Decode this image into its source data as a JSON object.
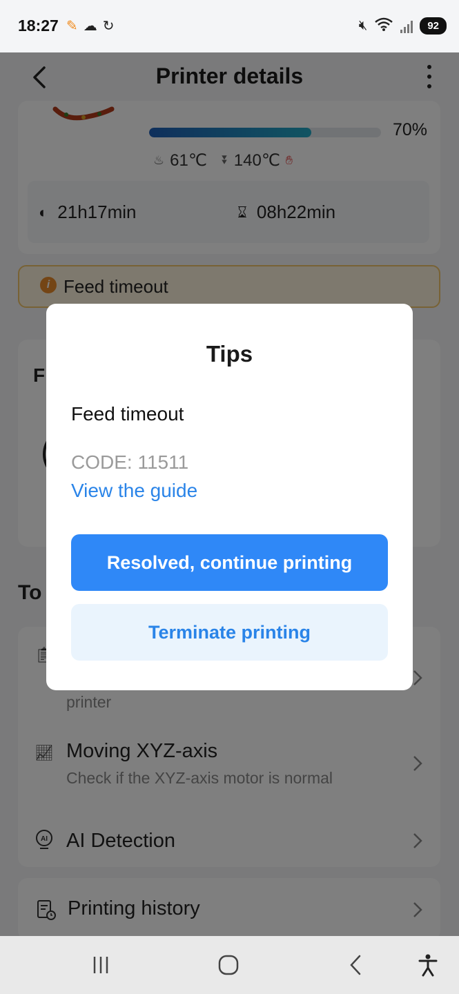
{
  "status_bar": {
    "time": "18:27",
    "battery": "92",
    "notif_icons": [
      "app-notification-icon",
      "weather-icon",
      "sync-icon"
    ],
    "right_icons": [
      "mute-icon",
      "wifi-icon",
      "signal-icon"
    ]
  },
  "header": {
    "title": "Printer details"
  },
  "print_status": {
    "progress": 0.7,
    "progress_label": "70%",
    "bed_temp": "61℃",
    "nozzle_temp": "140℃",
    "elapsed_time": "21h17min",
    "remaining_time": "08h22min"
  },
  "warning": {
    "text": "Feed timeout"
  },
  "filament": {
    "title": "F"
  },
  "tools": {
    "heading": "To",
    "items": [
      {
        "title": "",
        "subtitle": "printer"
      },
      {
        "title": "Moving XYZ-axis",
        "subtitle": "Check if the XYZ-axis motor is normal"
      },
      {
        "title": "AI Detection",
        "subtitle": ""
      },
      {
        "title": "Printing history",
        "subtitle": ""
      }
    ]
  },
  "dialog": {
    "title": "Tips",
    "message": "Feed timeout",
    "code": "CODE: 11511",
    "guide_link": "View the guide",
    "primary_button": "Resolved, continue printing",
    "secondary_button": "Terminate printing"
  },
  "colors": {
    "primary": "#2f88f7",
    "link": "#2a84e8",
    "secondary_bg": "#eaf4fd",
    "warning_bg": "#fdf3dc",
    "warning_border": "#f0c56a"
  }
}
